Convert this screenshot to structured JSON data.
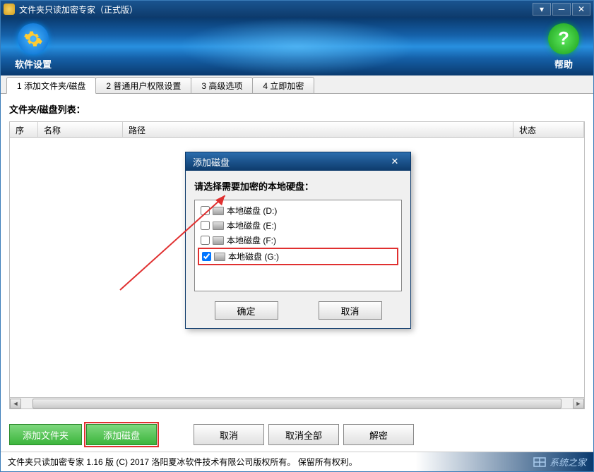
{
  "titlebar": {
    "title": "文件夹只读加密专家（正式版）"
  },
  "toolbar": {
    "settings_label": "软件设置",
    "help_label": "帮助"
  },
  "tabs": [
    {
      "label": "1 添加文件夹/磁盘",
      "active": true
    },
    {
      "label": "2 普通用户权限设置",
      "active": false
    },
    {
      "label": "3 高级选项",
      "active": false
    },
    {
      "label": "4 立即加密",
      "active": false
    }
  ],
  "content": {
    "list_label": "文件夹/磁盘列表：",
    "columns": {
      "index": "序号",
      "name": "名称",
      "path": "路径",
      "status": "状态"
    }
  },
  "buttons": {
    "add_folder": "添加文件夹",
    "add_disk": "添加磁盘",
    "cancel": "取消",
    "cancel_all": "取消全部",
    "decrypt": "解密"
  },
  "statusbar": {
    "text": "文件夹只读加密专家 1.16 版 (C) 2017 洛阳夏冰软件技术有限公司版权所有。 保留所有权利。",
    "watermark": "系统之家"
  },
  "dialog": {
    "title": "添加磁盘",
    "prompt": "请选择需要加密的本地硬盘：",
    "disks": [
      {
        "label": "本地磁盘 (D:)",
        "checked": false,
        "highlighted": false
      },
      {
        "label": "本地磁盘 (E:)",
        "checked": false,
        "highlighted": false
      },
      {
        "label": "本地磁盘 (F:)",
        "checked": false,
        "highlighted": false
      },
      {
        "label": "本地磁盘 (G:)",
        "checked": true,
        "highlighted": true
      }
    ],
    "ok": "确定",
    "cancel": "取消"
  }
}
